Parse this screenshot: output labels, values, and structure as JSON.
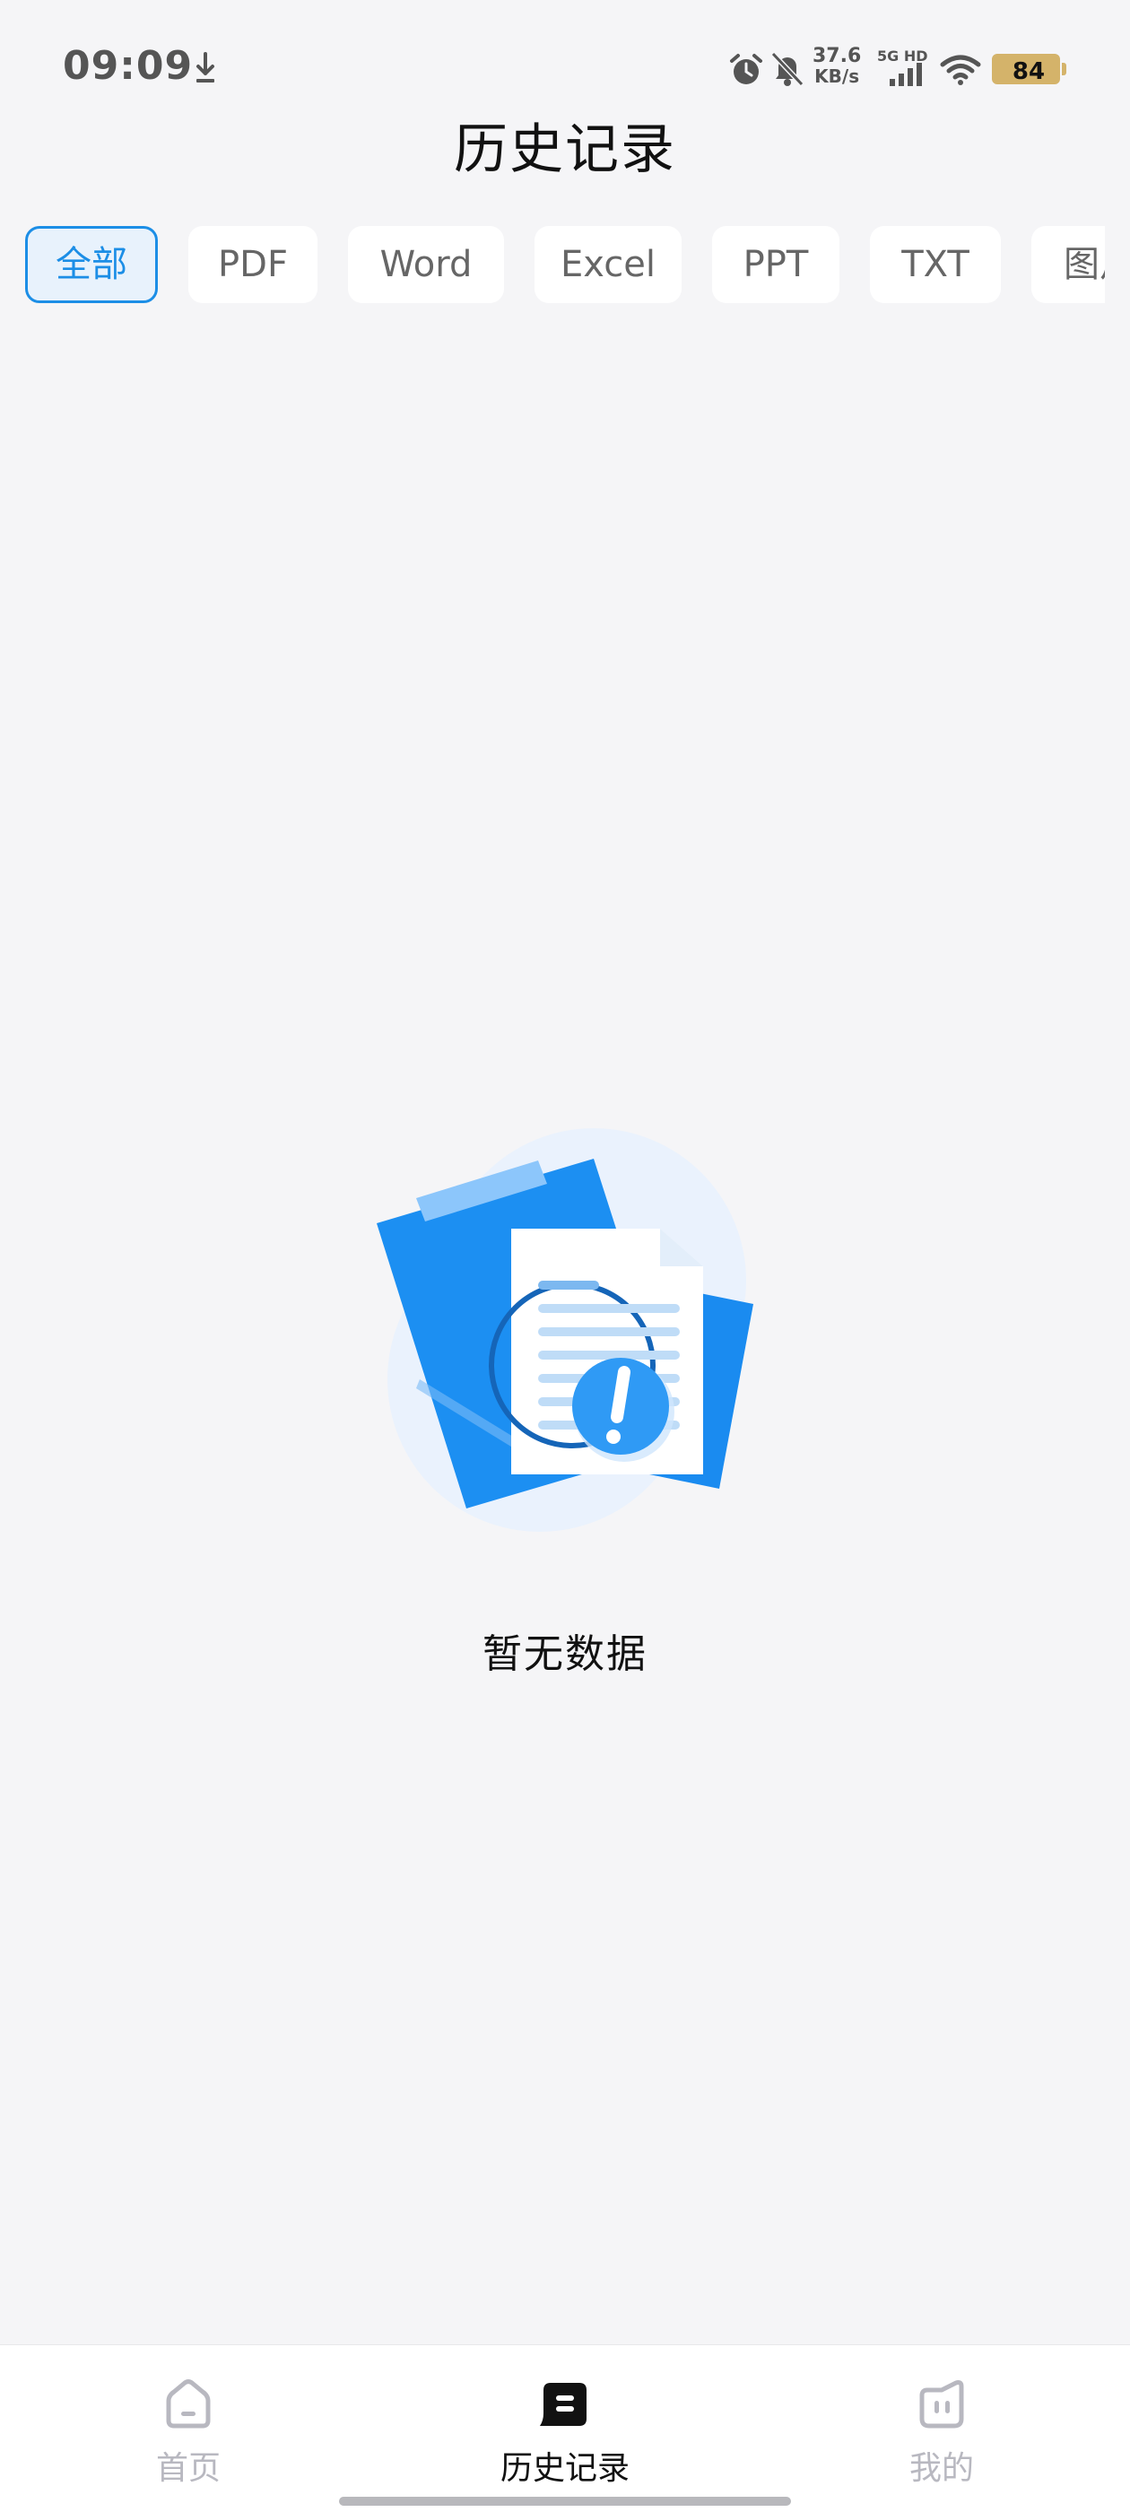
{
  "status_bar": {
    "time": "09:09",
    "net_speed_value": "37.6",
    "net_speed_unit": "KB/s",
    "network_type": "5G HD",
    "battery_level": "84",
    "icons": [
      "download-icon",
      "alarm-icon",
      "mute-icon",
      "signal-icon",
      "wifi-icon",
      "battery-icon"
    ]
  },
  "header": {
    "title": "历史记录"
  },
  "filter_tabs": [
    {
      "label": "全部",
      "active": true
    },
    {
      "label": "PDF",
      "active": false
    },
    {
      "label": "Word",
      "active": false
    },
    {
      "label": "Excel",
      "active": false
    },
    {
      "label": "PPT",
      "active": false
    },
    {
      "label": "TXT",
      "active": false
    },
    {
      "label": "图片",
      "active": false
    }
  ],
  "empty_state": {
    "message": "暂无数据",
    "illustration": "empty-document-icon"
  },
  "bottom_nav": {
    "items": [
      {
        "label": "首页",
        "icon": "home-icon",
        "active": false
      },
      {
        "label": "历史记录",
        "icon": "history-icon",
        "active": true
      },
      {
        "label": "我的",
        "icon": "profile-icon",
        "active": false
      }
    ]
  },
  "colors": {
    "accent": "#1c8ee6",
    "background": "#f5f5f7",
    "inactive": "#b8b8c0",
    "battery": "#d4b36a"
  }
}
